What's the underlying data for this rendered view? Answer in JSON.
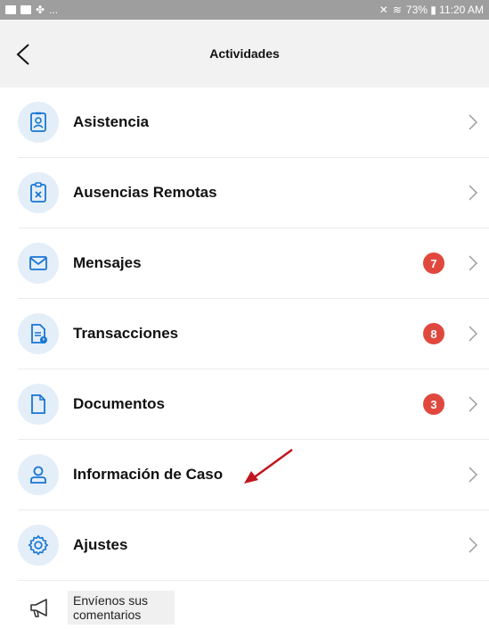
{
  "status_bar": {
    "left_text": "...",
    "right_text": "73% ▮ 11:20 AM"
  },
  "header": {
    "title": "Actividades"
  },
  "menu": {
    "items": [
      {
        "label": "Asistencia",
        "icon": "badge-icon",
        "badge": null
      },
      {
        "label": "Ausencias Remotas",
        "icon": "clipboard-x-icon",
        "badge": null
      },
      {
        "label": "Mensajes",
        "icon": "envelope-icon",
        "badge": "7"
      },
      {
        "label": "Transacciones",
        "icon": "document-clock-icon",
        "badge": "8"
      },
      {
        "label": "Documentos",
        "icon": "file-icon",
        "badge": "3"
      },
      {
        "label": "Información de Caso",
        "icon": "user-icon",
        "badge": null
      },
      {
        "label": "Ajustes",
        "icon": "gear-icon",
        "badge": null
      }
    ]
  },
  "feedback": {
    "label": "Envíenos sus comentarios",
    "icon": "megaphone-icon"
  },
  "colors": {
    "accent": "#1976d2",
    "icon_bg": "#e3eef9",
    "badge": "#e0483e",
    "annotation_arrow": "#c0161d"
  }
}
